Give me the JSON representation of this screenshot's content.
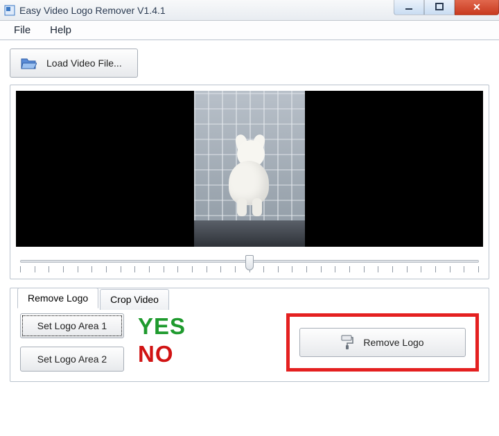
{
  "window": {
    "title": "Easy Video Logo Remover V1.4.1"
  },
  "menu": {
    "file": "File",
    "help": "Help"
  },
  "toolbar": {
    "load": "Load Video File..."
  },
  "tabs": {
    "remove": "Remove Logo",
    "crop": "Crop Video"
  },
  "buttons": {
    "set_area_1": "Set Logo Area 1",
    "set_area_2": "Set Logo Area 2",
    "remove_logo": "Remove Logo"
  },
  "annotations": {
    "yes": "YES",
    "no": "NO"
  },
  "slider": {
    "ticks": 33
  }
}
